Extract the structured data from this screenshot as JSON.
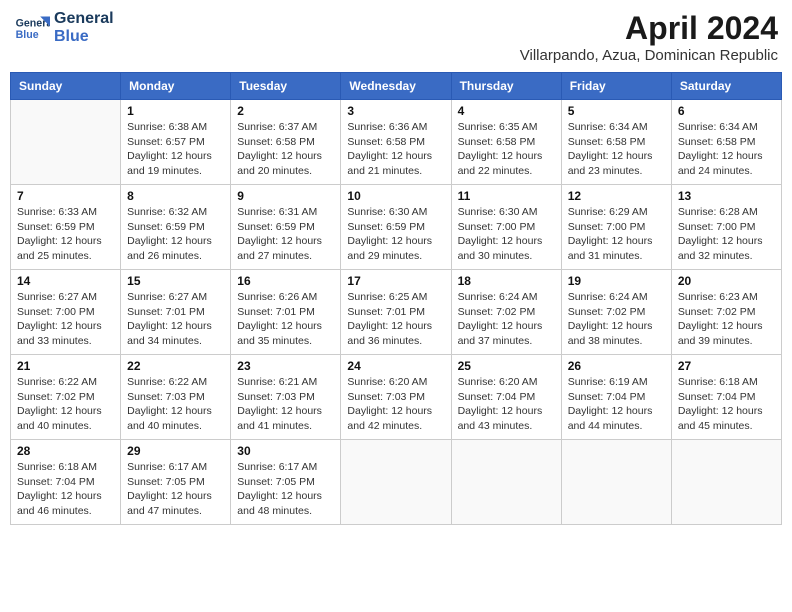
{
  "header": {
    "logo_line1": "General",
    "logo_line2": "Blue",
    "title": "April 2024",
    "subtitle": "Villarpando, Azua, Dominican Republic"
  },
  "weekdays": [
    "Sunday",
    "Monday",
    "Tuesday",
    "Wednesday",
    "Thursday",
    "Friday",
    "Saturday"
  ],
  "weeks": [
    [
      {
        "day": "",
        "info": ""
      },
      {
        "day": "1",
        "info": "Sunrise: 6:38 AM\nSunset: 6:57 PM\nDaylight: 12 hours\nand 19 minutes."
      },
      {
        "day": "2",
        "info": "Sunrise: 6:37 AM\nSunset: 6:58 PM\nDaylight: 12 hours\nand 20 minutes."
      },
      {
        "day": "3",
        "info": "Sunrise: 6:36 AM\nSunset: 6:58 PM\nDaylight: 12 hours\nand 21 minutes."
      },
      {
        "day": "4",
        "info": "Sunrise: 6:35 AM\nSunset: 6:58 PM\nDaylight: 12 hours\nand 22 minutes."
      },
      {
        "day": "5",
        "info": "Sunrise: 6:34 AM\nSunset: 6:58 PM\nDaylight: 12 hours\nand 23 minutes."
      },
      {
        "day": "6",
        "info": "Sunrise: 6:34 AM\nSunset: 6:58 PM\nDaylight: 12 hours\nand 24 minutes."
      }
    ],
    [
      {
        "day": "7",
        "info": "Sunrise: 6:33 AM\nSunset: 6:59 PM\nDaylight: 12 hours\nand 25 minutes."
      },
      {
        "day": "8",
        "info": "Sunrise: 6:32 AM\nSunset: 6:59 PM\nDaylight: 12 hours\nand 26 minutes."
      },
      {
        "day": "9",
        "info": "Sunrise: 6:31 AM\nSunset: 6:59 PM\nDaylight: 12 hours\nand 27 minutes."
      },
      {
        "day": "10",
        "info": "Sunrise: 6:30 AM\nSunset: 6:59 PM\nDaylight: 12 hours\nand 29 minutes."
      },
      {
        "day": "11",
        "info": "Sunrise: 6:30 AM\nSunset: 7:00 PM\nDaylight: 12 hours\nand 30 minutes."
      },
      {
        "day": "12",
        "info": "Sunrise: 6:29 AM\nSunset: 7:00 PM\nDaylight: 12 hours\nand 31 minutes."
      },
      {
        "day": "13",
        "info": "Sunrise: 6:28 AM\nSunset: 7:00 PM\nDaylight: 12 hours\nand 32 minutes."
      }
    ],
    [
      {
        "day": "14",
        "info": "Sunrise: 6:27 AM\nSunset: 7:00 PM\nDaylight: 12 hours\nand 33 minutes."
      },
      {
        "day": "15",
        "info": "Sunrise: 6:27 AM\nSunset: 7:01 PM\nDaylight: 12 hours\nand 34 minutes."
      },
      {
        "day": "16",
        "info": "Sunrise: 6:26 AM\nSunset: 7:01 PM\nDaylight: 12 hours\nand 35 minutes."
      },
      {
        "day": "17",
        "info": "Sunrise: 6:25 AM\nSunset: 7:01 PM\nDaylight: 12 hours\nand 36 minutes."
      },
      {
        "day": "18",
        "info": "Sunrise: 6:24 AM\nSunset: 7:02 PM\nDaylight: 12 hours\nand 37 minutes."
      },
      {
        "day": "19",
        "info": "Sunrise: 6:24 AM\nSunset: 7:02 PM\nDaylight: 12 hours\nand 38 minutes."
      },
      {
        "day": "20",
        "info": "Sunrise: 6:23 AM\nSunset: 7:02 PM\nDaylight: 12 hours\nand 39 minutes."
      }
    ],
    [
      {
        "day": "21",
        "info": "Sunrise: 6:22 AM\nSunset: 7:02 PM\nDaylight: 12 hours\nand 40 minutes."
      },
      {
        "day": "22",
        "info": "Sunrise: 6:22 AM\nSunset: 7:03 PM\nDaylight: 12 hours\nand 40 minutes."
      },
      {
        "day": "23",
        "info": "Sunrise: 6:21 AM\nSunset: 7:03 PM\nDaylight: 12 hours\nand 41 minutes."
      },
      {
        "day": "24",
        "info": "Sunrise: 6:20 AM\nSunset: 7:03 PM\nDaylight: 12 hours\nand 42 minutes."
      },
      {
        "day": "25",
        "info": "Sunrise: 6:20 AM\nSunset: 7:04 PM\nDaylight: 12 hours\nand 43 minutes."
      },
      {
        "day": "26",
        "info": "Sunrise: 6:19 AM\nSunset: 7:04 PM\nDaylight: 12 hours\nand 44 minutes."
      },
      {
        "day": "27",
        "info": "Sunrise: 6:18 AM\nSunset: 7:04 PM\nDaylight: 12 hours\nand 45 minutes."
      }
    ],
    [
      {
        "day": "28",
        "info": "Sunrise: 6:18 AM\nSunset: 7:04 PM\nDaylight: 12 hours\nand 46 minutes."
      },
      {
        "day": "29",
        "info": "Sunrise: 6:17 AM\nSunset: 7:05 PM\nDaylight: 12 hours\nand 47 minutes."
      },
      {
        "day": "30",
        "info": "Sunrise: 6:17 AM\nSunset: 7:05 PM\nDaylight: 12 hours\nand 48 minutes."
      },
      {
        "day": "",
        "info": ""
      },
      {
        "day": "",
        "info": ""
      },
      {
        "day": "",
        "info": ""
      },
      {
        "day": "",
        "info": ""
      }
    ]
  ]
}
